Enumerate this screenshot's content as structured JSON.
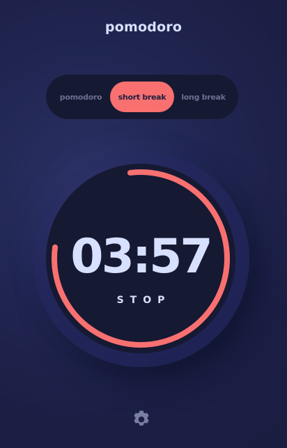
{
  "app": {
    "title": "pomodoro"
  },
  "modes": {
    "items": [
      {
        "label": "pomodoro",
        "active": false
      },
      {
        "label": "short break",
        "active": true
      },
      {
        "label": "long break",
        "active": false
      }
    ]
  },
  "timer": {
    "time": "03:57",
    "action_label": "STOP",
    "progress_fraction": 0.79
  },
  "settings": {
    "icon": "gear-icon"
  },
  "colors": {
    "accent": "#f87070",
    "text": "#d7e0ff",
    "background": "#1e213f",
    "panel": "#161932"
  }
}
